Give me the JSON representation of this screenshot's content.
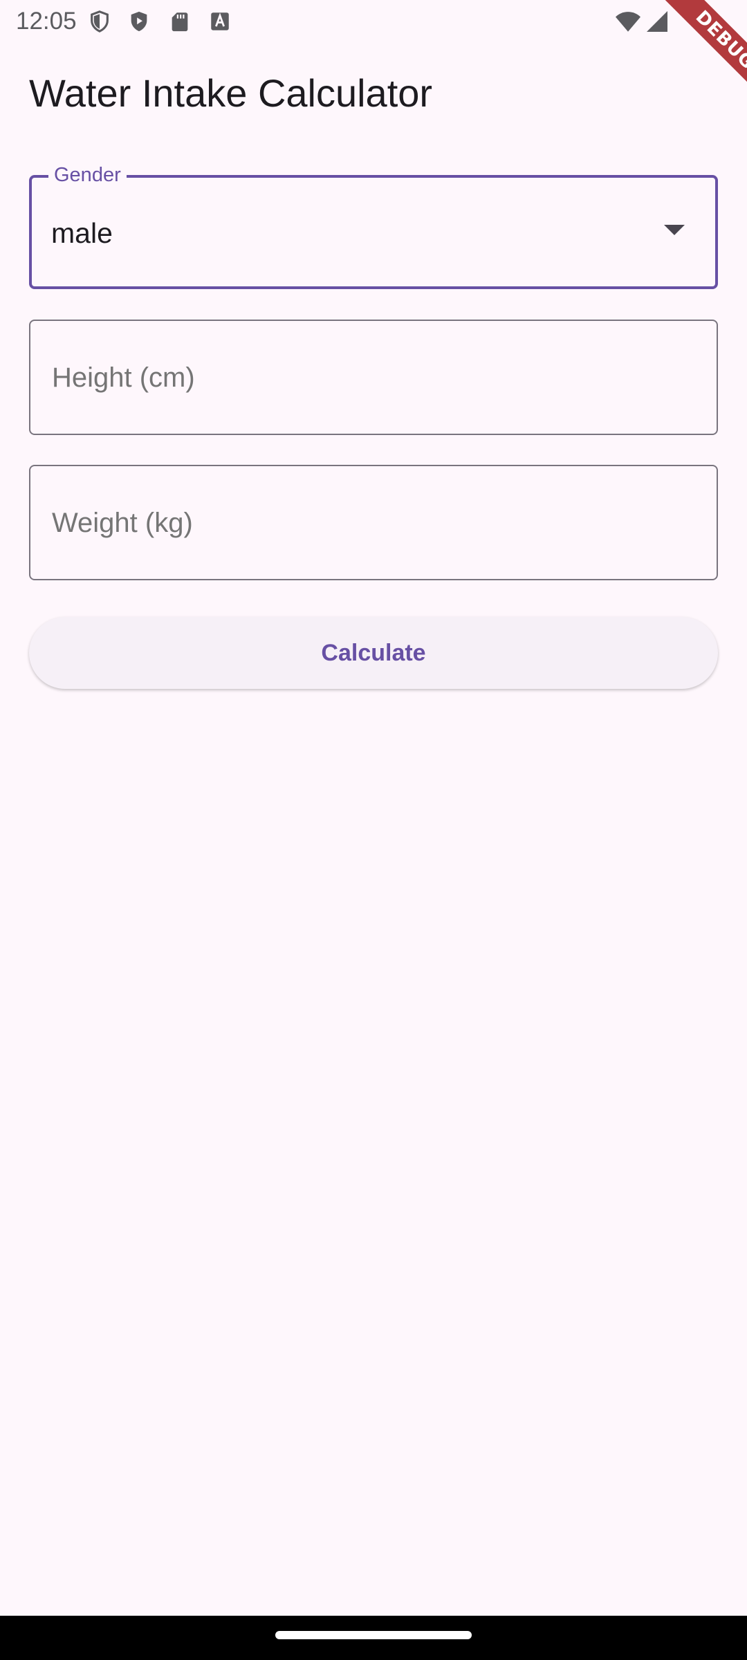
{
  "status_bar": {
    "time": "12:05",
    "icons": [
      "shield-icon",
      "play-protect-icon",
      "sd-card-icon",
      "a-icon",
      "wifi-icon",
      "signal-icon"
    ]
  },
  "debug_banner": "DEBUG",
  "app": {
    "title": "Water Intake Calculator"
  },
  "form": {
    "gender": {
      "label": "Gender",
      "value": "male"
    },
    "height": {
      "placeholder": "Height (cm)",
      "value": ""
    },
    "weight": {
      "placeholder": "Weight (kg)",
      "value": ""
    },
    "calculate_label": "Calculate"
  },
  "colors": {
    "primary": "#6750a4",
    "background": "#fef7fc",
    "outline": "#79747e",
    "debug_red": "#b23a3d"
  }
}
